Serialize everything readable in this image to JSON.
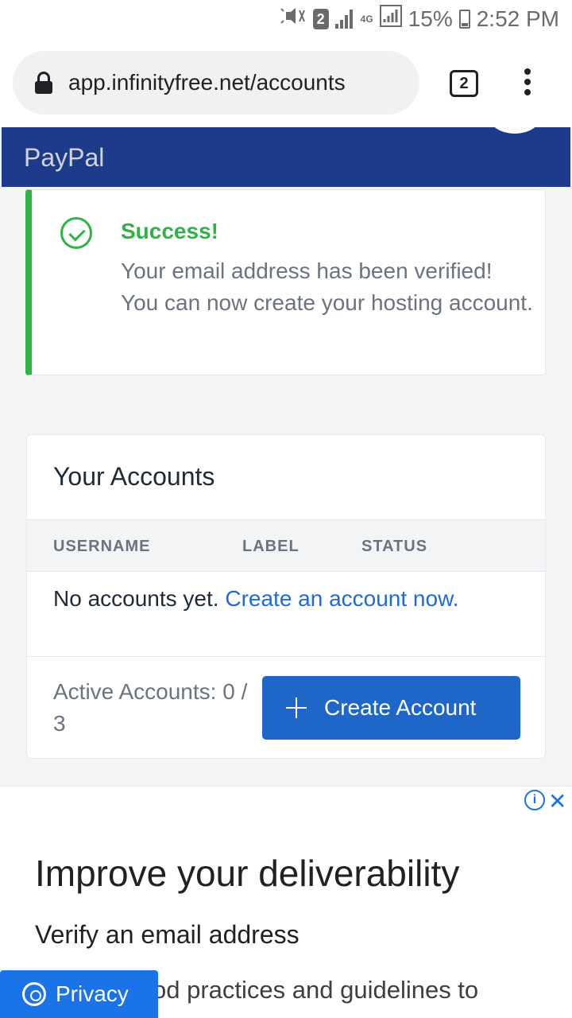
{
  "status_bar": {
    "sim_slot": "2",
    "network": "4G",
    "battery": "15%",
    "time": "2:52 PM"
  },
  "browser": {
    "url": "app.infinityfree.net/accounts",
    "tab_count": "2"
  },
  "header": {
    "brand": "PayPal"
  },
  "alert": {
    "title": "Success!",
    "message": "Your email address has been verified! You can now create your hosting account.",
    "color": "#2fb344"
  },
  "accounts_card": {
    "title": "Your Accounts",
    "columns": [
      "USERNAME",
      "LABEL",
      "STATUS"
    ],
    "empty_text": "No accounts yet.",
    "empty_link": "Create an account now.",
    "active_accounts": "Active Accounts: 0 / 3",
    "create_button": "Create Account",
    "accent": "#1e66c8"
  },
  "ad": {
    "headline": "Improve your deliverability",
    "subheadline": "Verify an email address",
    "body": "od practices and guidelines to",
    "info_icon": "info-icon",
    "close_icon": "close-icon"
  },
  "privacy_button": {
    "label": "Privacy",
    "icon": "gear-icon"
  }
}
